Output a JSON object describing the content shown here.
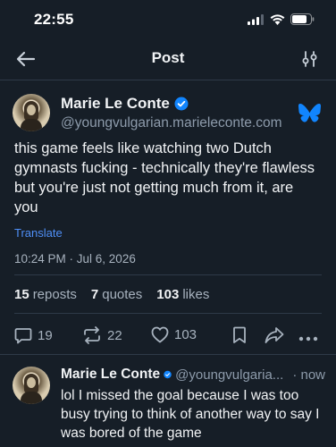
{
  "status_bar": {
    "time": "22:55",
    "signal_icon": "cellular-signal-icon",
    "wifi_icon": "wifi-icon",
    "battery_icon": "battery-icon"
  },
  "header": {
    "title": "Post",
    "back_icon": "arrow-left-icon",
    "settings_icon": "sliders-icon"
  },
  "post": {
    "author": {
      "name": "Marie Le Conte",
      "handle": "@youngvulgarian.marieleconte.com",
      "verified": true
    },
    "text": "this game feels like watching two Dutch gymnasts fucking - technically they're flawless but you're just not getting much from it, are you",
    "translate_label": "Translate",
    "timestamp": "10:24 PM · Jul 6, 2026",
    "stats": {
      "reposts_count": "15",
      "reposts_label": "reposts",
      "quotes_count": "7",
      "quotes_label": "quotes",
      "likes_count": "103",
      "likes_label": "likes"
    },
    "actions": {
      "replies": "19",
      "reposts": "22",
      "likes": "103"
    }
  },
  "reply": {
    "author": {
      "name": "Marie Le Conte",
      "handle": "@youngvulgaria...",
      "verified": true
    },
    "time": "· now",
    "text": "lol I missed the goal because I was too busy trying to think of another way to say I was bored of the game"
  },
  "colors": {
    "background": "#161e27",
    "accent": "#4f8ff7",
    "verified": "#1185fe",
    "bluesky": "#1185fe"
  }
}
